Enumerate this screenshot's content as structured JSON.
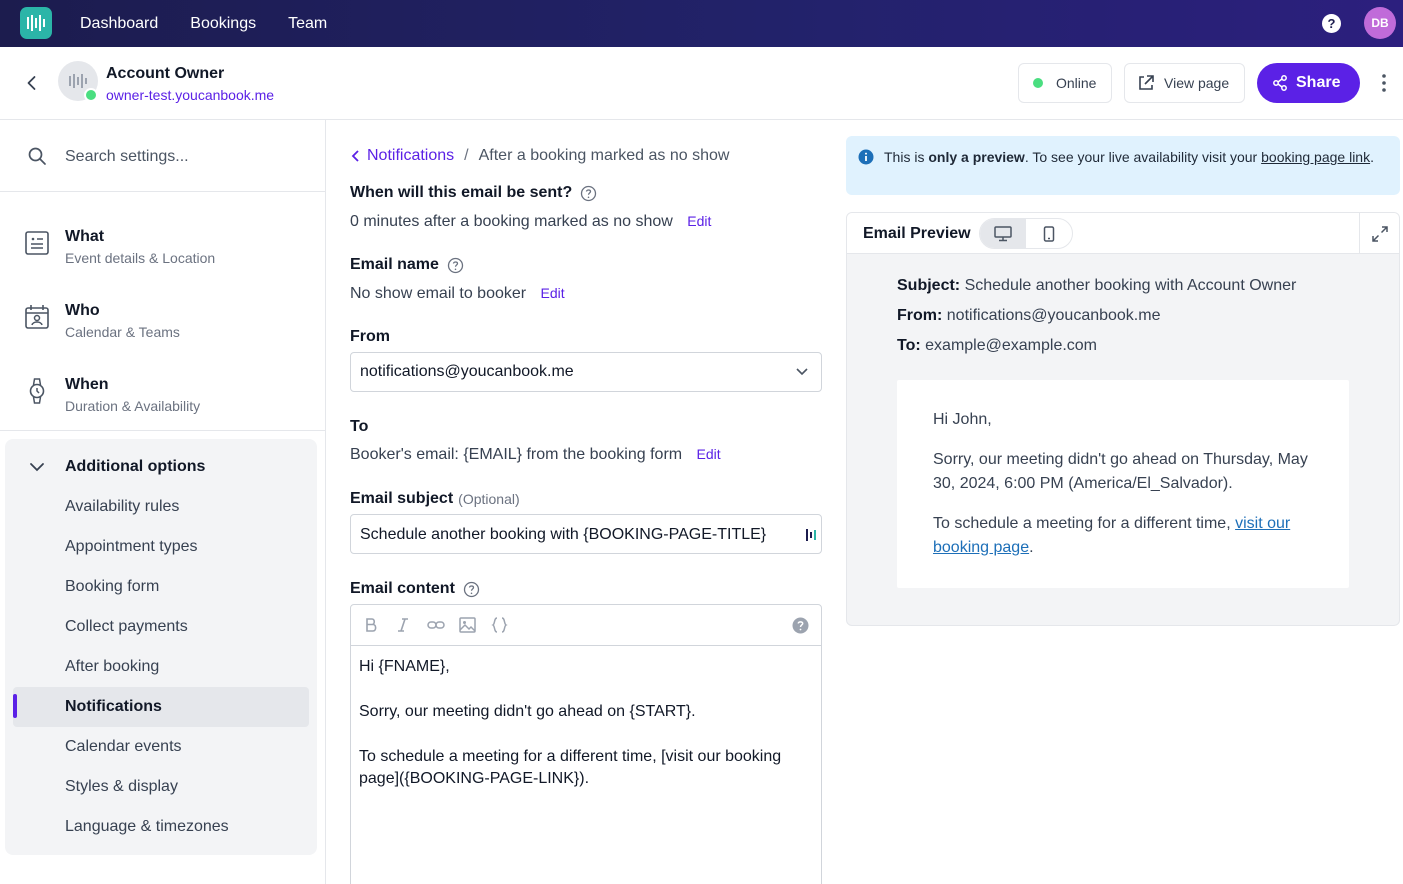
{
  "colors": {
    "accent": "#5b21e6",
    "online": "#4ade80",
    "nav_bg": "#1c1c4e",
    "info_bg": "#e0f2fe"
  },
  "topnav": {
    "links": [
      "Dashboard",
      "Bookings",
      "Team"
    ],
    "help_label": "?",
    "user_initials": "DB"
  },
  "header": {
    "account_name": "Account Owner",
    "account_url": "owner-test.youcanbook.me",
    "online_label": "Online",
    "view_page_label": "View page",
    "share_label": "Share"
  },
  "sidebar": {
    "search_placeholder": "Search settings...",
    "main_items": [
      {
        "title": "What",
        "subtitle": "Event details & Location",
        "icon": "document-icon"
      },
      {
        "title": "Who",
        "subtitle": "Calendar & Teams",
        "icon": "calendar-user-icon"
      },
      {
        "title": "When",
        "subtitle": "Duration & Availability",
        "icon": "watch-icon"
      }
    ],
    "additional_options": {
      "heading": "Additional options",
      "items": [
        "Availability rules",
        "Appointment types",
        "Booking form",
        "Collect payments",
        "After booking",
        "Notifications",
        "Calendar events",
        "Styles & display",
        "Language & timezones"
      ],
      "active": "Notifications"
    }
  },
  "form": {
    "breadcrumb": {
      "parent": "Notifications",
      "separator": "/",
      "current": "After a booking marked as no show"
    },
    "when_label": "When will this email be sent?",
    "when_value": "0 minutes after a booking marked as no show",
    "edit_label": "Edit",
    "name_label": "Email name",
    "name_value": "No show email to booker",
    "from_label": "From",
    "from_value": "notifications@youcanbook.me",
    "to_label": "To",
    "to_value": "Booker's email: {EMAIL} from the booking form",
    "subject_label": "Email subject",
    "subject_optional": "(Optional)",
    "subject_value": "Schedule another booking with {BOOKING-PAGE-TITLE}",
    "content_label": "Email content",
    "content_lines": [
      "Hi {FNAME},",
      "Sorry, our meeting didn't go ahead on {START}.",
      "To schedule a meeting for a different time, [visit our booking page]({BOOKING-PAGE-LINK})."
    ]
  },
  "preview": {
    "info_prefix": "This is ",
    "info_bold": "only a preview",
    "info_middle": ". To see your live availability visit your ",
    "info_link": "booking page link",
    "info_suffix": ".",
    "title": "Email Preview",
    "subject_label": "Subject:",
    "subject_value": "Schedule another booking with Account Owner",
    "from_label": "From:",
    "from_value": "notifications@youcanbook.me",
    "to_label": "To:",
    "to_value": "example@example.com",
    "greeting": "Hi John,",
    "body1": "Sorry, our meeting didn't go ahead on Thursday, May 30, 2024, 6:00 PM (America/El_Salvador).",
    "body2_prefix": "To schedule a meeting for a different time, ",
    "body2_link": "visit our booking page",
    "body2_suffix": "."
  }
}
